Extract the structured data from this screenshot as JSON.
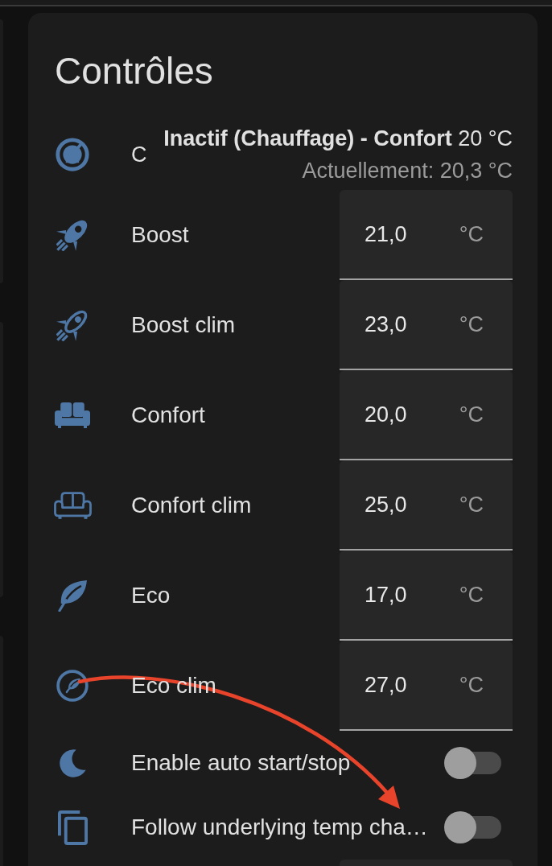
{
  "card": {
    "title": "Contrôles",
    "rows": [
      {
        "kind": "climate",
        "name": "C",
        "state": "**Inactif (Chauffage) - Confort** 20 °C",
        "current": "Actuellement: 20,3 °C"
      },
      {
        "kind": "number",
        "name": "Boost",
        "value": "21,0",
        "unit": "°C"
      },
      {
        "kind": "number",
        "name": "Boost clim",
        "value": "23,0",
        "unit": "°C"
      },
      {
        "kind": "number",
        "name": "Confort",
        "value": "20,0",
        "unit": "°C"
      },
      {
        "kind": "number",
        "name": "Confort clim",
        "value": "25,0",
        "unit": "°C"
      },
      {
        "kind": "number",
        "name": "Eco",
        "value": "17,0",
        "unit": "°C"
      },
      {
        "kind": "number",
        "name": "Eco clim",
        "value": "27,0",
        "unit": "°C"
      },
      {
        "kind": "toggle",
        "name": "Enable auto start/stop",
        "on": false
      },
      {
        "kind": "toggle",
        "name": "Follow underlying temp cha…",
        "on": false
      }
    ]
  }
}
